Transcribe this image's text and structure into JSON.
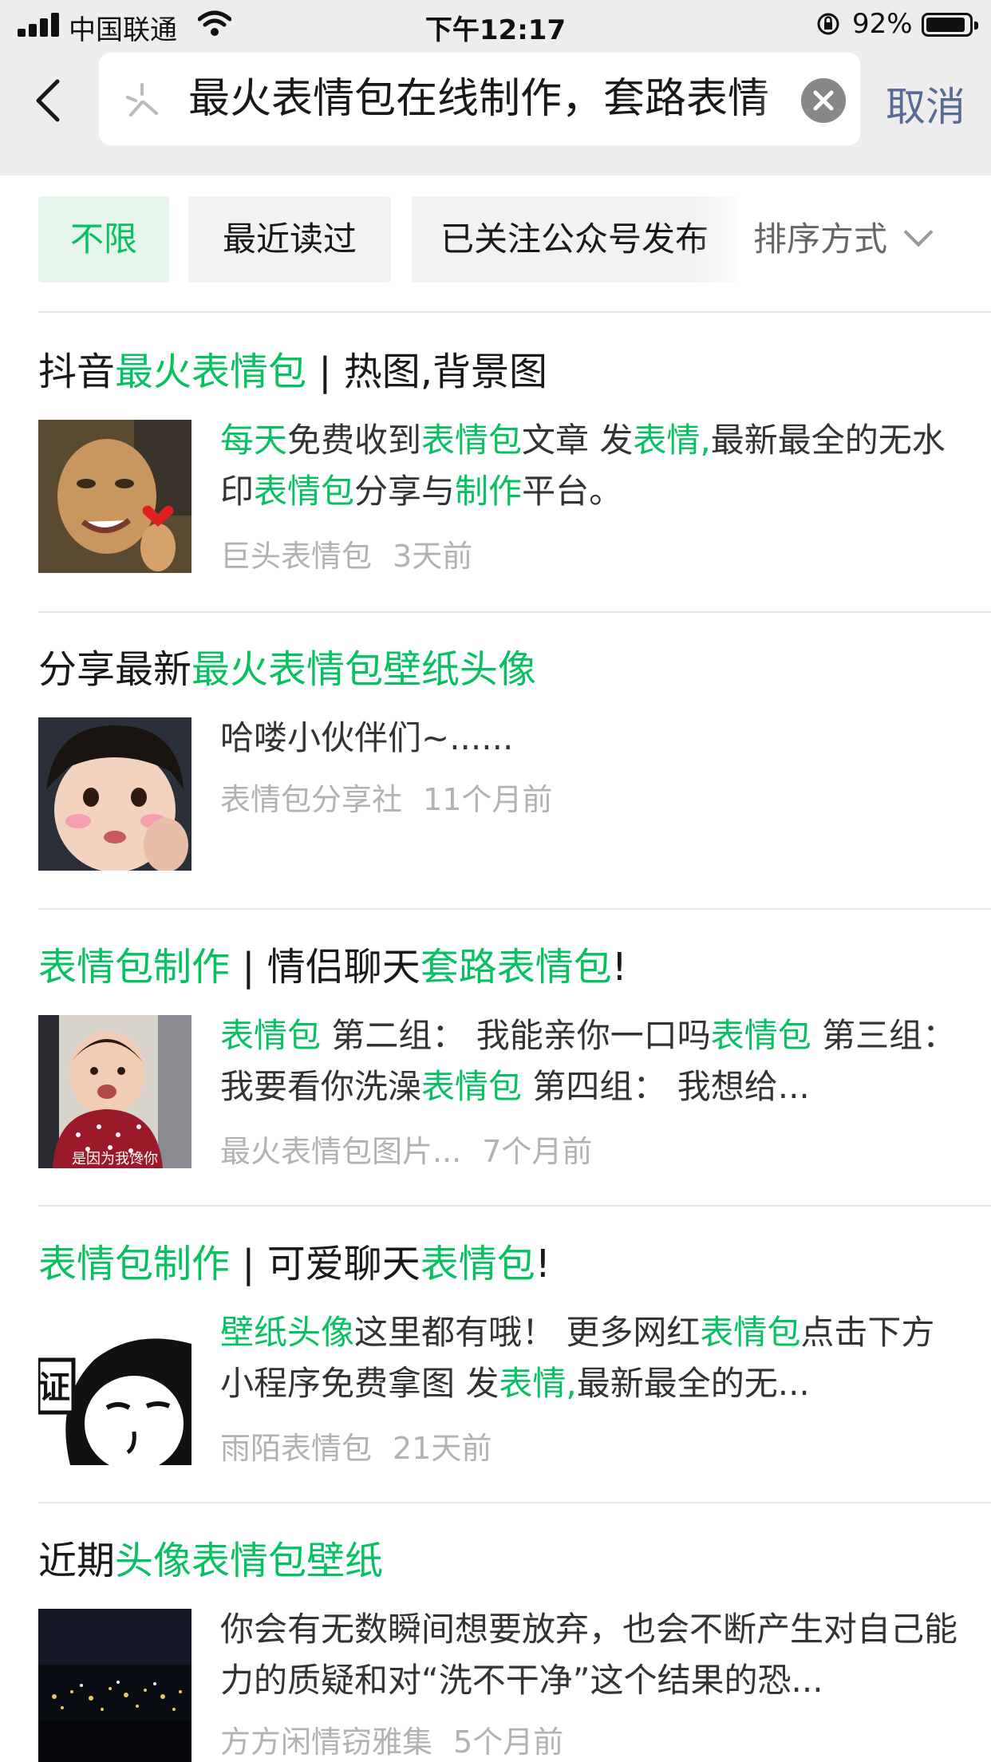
{
  "status_bar": {
    "carrier": "中国联通",
    "time": "下午12:17",
    "battery": "92%"
  },
  "header": {
    "search_query": "最火表情包在线制作，套路表情",
    "cancel_label": "取消"
  },
  "filters": {
    "chips": [
      "不限",
      "最近读过",
      "已关注公众号发布"
    ],
    "active_index": 0,
    "sort_label": "排序方式"
  },
  "results": [
    {
      "title": [
        {
          "t": "抖音",
          "hl": false
        },
        {
          "t": "最火表情包",
          "hl": true
        },
        {
          "t": " | 热图,背景图",
          "hl": false
        }
      ],
      "snippet": [
        {
          "t": "每天",
          "hl": true
        },
        {
          "t": "免费收到",
          "hl": false
        },
        {
          "t": "表情包",
          "hl": true
        },
        {
          "t": "文章 发",
          "hl": false
        },
        {
          "t": "表情,",
          "hl": true
        },
        {
          "t": "最新最全的无水印",
          "hl": false
        },
        {
          "t": "表情包",
          "hl": true
        },
        {
          "t": "分享与",
          "hl": false
        },
        {
          "t": "制作",
          "hl": true
        },
        {
          "t": "平台。",
          "hl": false
        }
      ],
      "source": "巨头表情包",
      "time": "3天前",
      "thumb": "man-smiling-photo"
    },
    {
      "title": [
        {
          "t": "分享最新",
          "hl": false
        },
        {
          "t": "最火表情包壁纸头像",
          "hl": true
        }
      ],
      "snippet": [
        {
          "t": "哈喽小伙伴们~......",
          "hl": false
        }
      ],
      "source": "表情包分享社",
      "time": "11个月前",
      "thumb": "baby-girl-photo"
    },
    {
      "title": [
        {
          "t": "表情包制作",
          "hl": true
        },
        {
          "t": " | 情侣聊天",
          "hl": false
        },
        {
          "t": "套路表情包",
          "hl": true
        },
        {
          "t": "!",
          "hl": false
        }
      ],
      "snippet": [
        {
          "t": "表情包",
          "hl": true
        },
        {
          "t": " 第二组： 我能亲你一口吗",
          "hl": false
        },
        {
          "t": "表情包",
          "hl": true
        },
        {
          "t": " 第三组：我要看你洗澡",
          "hl": false
        },
        {
          "t": "表情包",
          "hl": true
        },
        {
          "t": " 第四组： 我想给...",
          "hl": false
        }
      ],
      "source": "最火表情包图片...",
      "time": "7个月前",
      "thumb": "baby-red-shirt-photo",
      "thumb_caption": "是因为我馋你"
    },
    {
      "title": [
        {
          "t": "表情包制作",
          "hl": true
        },
        {
          "t": " | 可爱聊天",
          "hl": false
        },
        {
          "t": "表情包",
          "hl": true
        },
        {
          "t": "!",
          "hl": false
        }
      ],
      "snippet": [
        {
          "t": "壁纸头像",
          "hl": true
        },
        {
          "t": "这里都有哦！ 更多网红",
          "hl": false
        },
        {
          "t": "表情包",
          "hl": true
        },
        {
          "t": "点击下方小程序免费拿图 发",
          "hl": false
        },
        {
          "t": "表情,",
          "hl": true
        },
        {
          "t": "最新最全的无...",
          "hl": false
        }
      ],
      "source": "雨陌表情包",
      "time": "21天前",
      "thumb": "panda-meme-drawing",
      "thumb_caption": "证"
    },
    {
      "title": [
        {
          "t": "近期",
          "hl": false
        },
        {
          "t": "头像表情包壁纸",
          "hl": true
        }
      ],
      "snippet": [
        {
          "t": "你会有无数瞬间想要放弃，也会不断产生对自己能力的质疑和对“洗不干净”这个结果的恐...",
          "hl": false
        }
      ],
      "source": "方方闲情窃雅集",
      "time": "5个月前",
      "thumb": "night-city-photo"
    }
  ],
  "colors": {
    "highlight": "#07c160",
    "link": "#576b95",
    "meta": "#b2b2b2",
    "header_bg": "#ededed"
  }
}
